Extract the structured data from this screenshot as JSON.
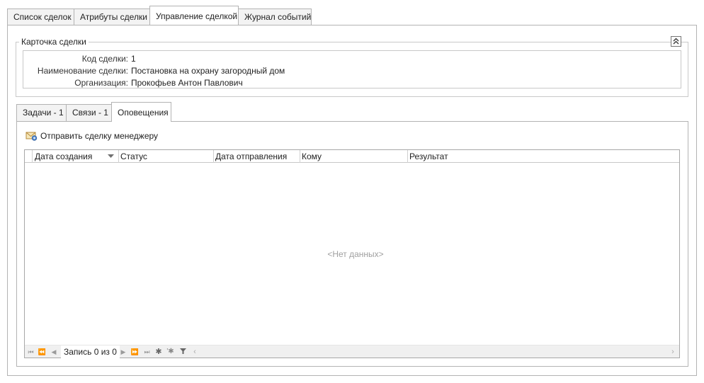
{
  "top_tabs": [
    "Список сделок",
    "Атрибуты сделки",
    "Управление сделкой",
    "Журнал событий"
  ],
  "card": {
    "title": "Карточка сделки",
    "fields": [
      {
        "label": "Код сделки:",
        "value": "1"
      },
      {
        "label": "Наименование сделки:",
        "value": "Постановка на охрану загородный дом"
      },
      {
        "label": "Организация:",
        "value": "Прокофьев Антон Павлович"
      }
    ],
    "collapse_icon": "double-chevron-up-icon"
  },
  "inner_tabs": [
    "Задачи - 1",
    "Связи - 1",
    "Оповещения"
  ],
  "toolbar": {
    "send_label": "Отправить сделку менеджеру",
    "send_icon": "envelope-user-icon"
  },
  "grid": {
    "columns": [
      "Дата создания",
      "Статус",
      "Дата отправления",
      "Кому",
      "Результат"
    ],
    "empty_text": "<Нет данных>"
  },
  "navigator": {
    "record_text": "Запись 0 из 0"
  }
}
